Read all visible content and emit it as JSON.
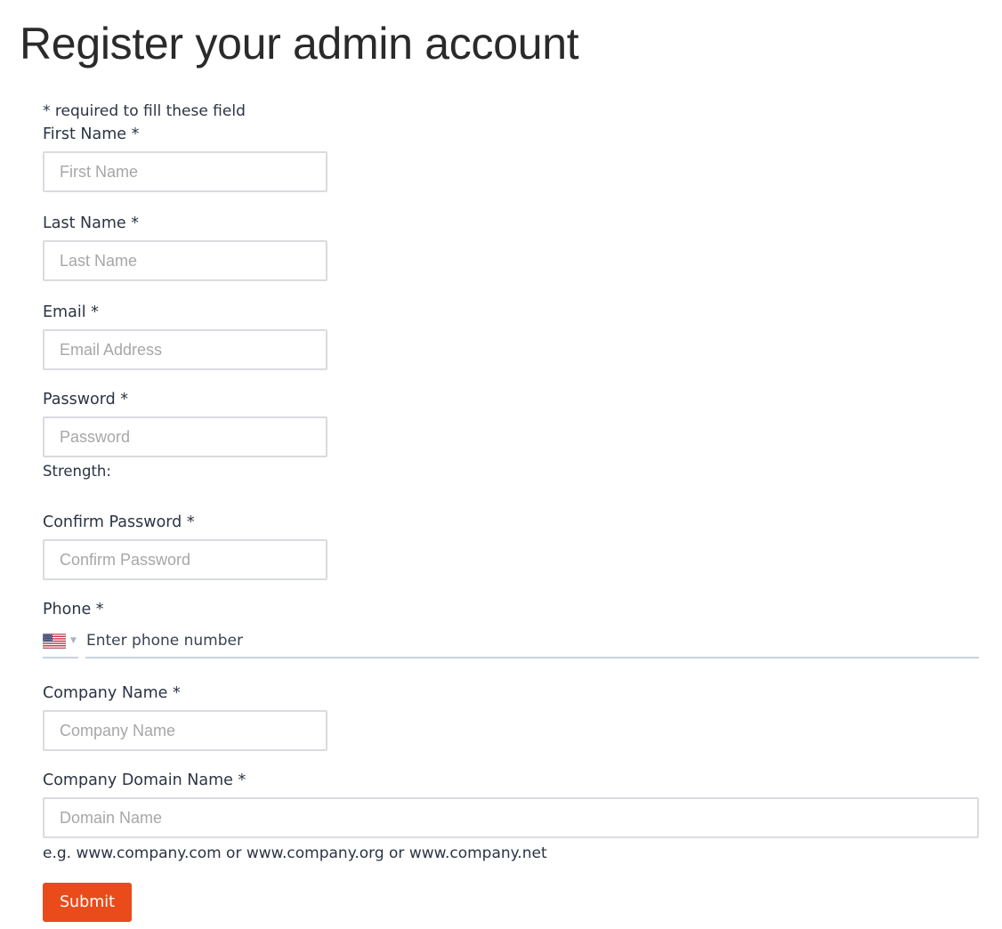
{
  "page": {
    "title": "Register your admin account"
  },
  "form": {
    "required_note": "* required to fill these field",
    "first_name": {
      "label": "First Name *",
      "placeholder": "First Name",
      "value": ""
    },
    "last_name": {
      "label": "Last Name *",
      "placeholder": "Last Name",
      "value": ""
    },
    "email": {
      "label": "Email *",
      "placeholder": "Email Address",
      "value": ""
    },
    "password": {
      "label": "Password *",
      "placeholder": "Password",
      "value": "",
      "strength_label": "Strength:"
    },
    "confirm_password": {
      "label": "Confirm Password *",
      "placeholder": "Confirm Password",
      "value": ""
    },
    "phone": {
      "label": "Phone *",
      "placeholder": "Enter phone number",
      "value": "",
      "country_icon": "us-flag-icon"
    },
    "company_name": {
      "label": "Company Name *",
      "placeholder": "Company Name",
      "value": ""
    },
    "company_domain": {
      "label": "Company Domain Name *",
      "placeholder": "Domain Name",
      "value": "",
      "hint": "e.g. www.company.com or www.company.org or www.company.net"
    },
    "submit_label": "Submit"
  },
  "colors": {
    "accent": "#ea4b1a",
    "text": "#2b3443",
    "input_border": "#d9dbe0",
    "placeholder": "#a7a7a7"
  }
}
